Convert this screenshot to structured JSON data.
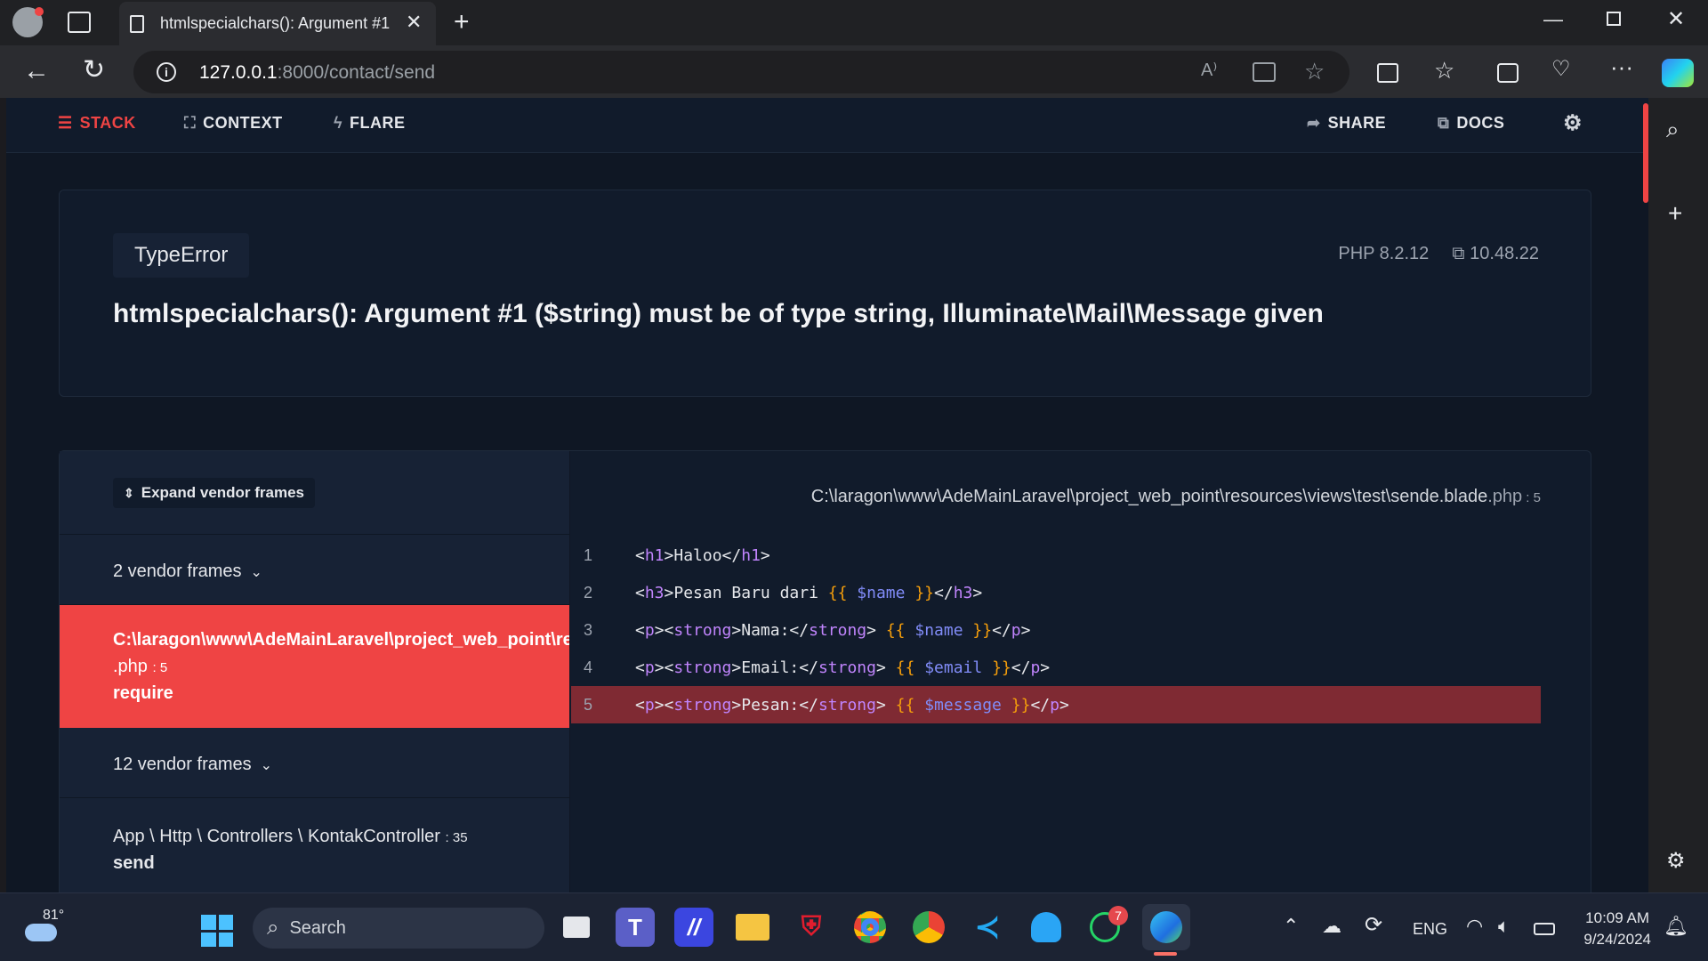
{
  "browser": {
    "tab_title": "htmlspecialchars(): Argument #1 (",
    "url_host": "127.0.0.1",
    "url_path": ":8000/contact/send"
  },
  "nav": {
    "stack": "STACK",
    "context": "CONTEXT",
    "flare": "FLARE",
    "share": "SHARE",
    "docs": "DOCS"
  },
  "error": {
    "exception": "TypeError",
    "message": "htmlspecialchars(): Argument #1 ($string) must be of type string, Illuminate\\Mail\\Message given",
    "php_version": "PHP 8.2.12",
    "laravel_version": "10.48.22"
  },
  "stack": {
    "expand_label": "Expand vendor frames",
    "vendor_frames_1": "2 vendor frames",
    "active_frame_path": "C:\\laragon\\www\\AdeMainLaravel\\project_web_point\\resources\\views\\test\\sende.blade",
    "active_frame_ext": ".php",
    "active_frame_line": ": 5",
    "active_frame_method": "require",
    "vendor_frames_2": "12 vendor frames",
    "app_frame_path": "App \\ Http \\ Controllers \\ KontakController",
    "app_frame_line": ": 35",
    "app_frame_method": "send"
  },
  "code": {
    "file_path": "C:\\laragon\\www\\AdeMainLaravel\\project_web_point\\resources\\views\\test\\sende.blade",
    "file_ext": ".php",
    "file_line": " : 5",
    "highlighted_line": 5,
    "lines": [
      {
        "n": "1"
      },
      {
        "n": "2"
      },
      {
        "n": "3"
      },
      {
        "n": "4"
      },
      {
        "n": "5"
      }
    ]
  },
  "taskbar": {
    "temperature": "81°",
    "search_placeholder": "Search",
    "language": "ENG",
    "time": "10:09 AM",
    "date": "9/24/2024",
    "whatsapp_badge": "7"
  },
  "colors": {
    "accent_red": "#ef4444",
    "highlight_line": "#7f2a33",
    "page_bg": "#0f1724"
  }
}
